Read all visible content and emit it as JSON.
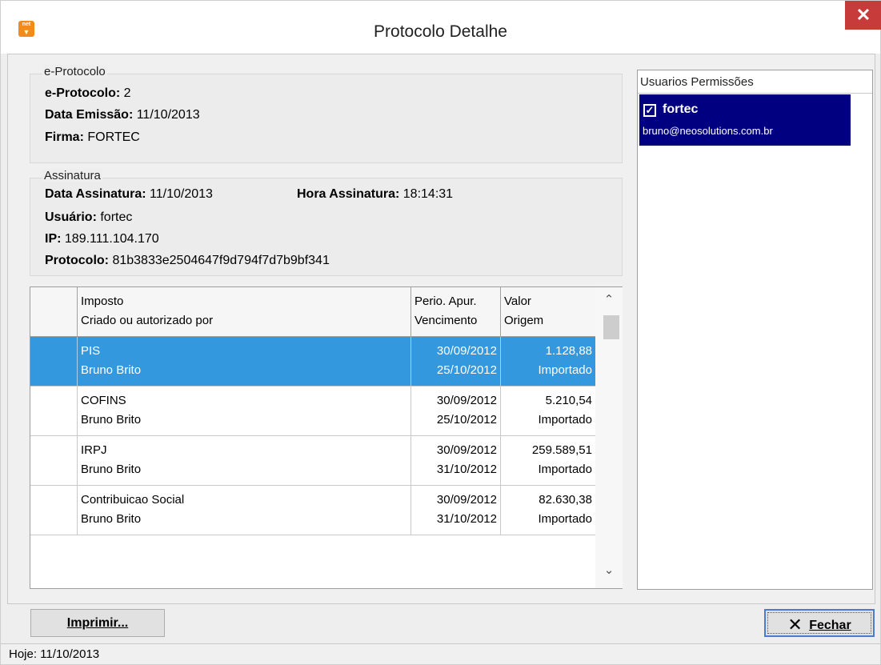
{
  "window": {
    "title": "Protocolo Detalhe",
    "app_icon_text": "net",
    "close_glyph": "✕"
  },
  "eprotocolo": {
    "caption": "e-Protocolo",
    "protocolo_label": "e-Protocolo:",
    "protocolo_value": "2",
    "data_emissao_label": "Data Emissão:",
    "data_emissao_value": "11/10/2013",
    "firma_label": "Firma:",
    "firma_value": "FORTEC"
  },
  "assinatura": {
    "caption": "Assinatura",
    "data_label": "Data Assinatura:",
    "data_value": "11/10/2013",
    "hora_label": "Hora Assinatura:",
    "hora_value": "18:14:31",
    "usuario_label": "Usuário:",
    "usuario_value": "fortec",
    "ip_label": "IP:",
    "ip_value": "189.111.104.170",
    "protocolo_label": "Protocolo:",
    "protocolo_value": "81b3833e2504647f9d794f7d7b9bf341"
  },
  "grid": {
    "headers": {
      "imposto": "Imposto",
      "criado": "Criado ou autorizado por",
      "perio": "Perio. Apur.",
      "vencimento": "Vencimento",
      "valor": "Valor",
      "origem": "Origem"
    },
    "rows": [
      {
        "imposto": "PIS",
        "criado": "Bruno Brito",
        "perio": "30/09/2012",
        "vencimento": "25/10/2012",
        "valor": "1.128,88",
        "origem": "Importado",
        "selected": true
      },
      {
        "imposto": "COFINS",
        "criado": "Bruno Brito",
        "perio": "30/09/2012",
        "vencimento": "25/10/2012",
        "valor": "5.210,54",
        "origem": "Importado",
        "selected": false
      },
      {
        "imposto": "IRPJ",
        "criado": "Bruno Brito",
        "perio": "30/09/2012",
        "vencimento": "31/10/2012",
        "valor": "259.589,51",
        "origem": "Importado",
        "selected": false
      },
      {
        "imposto": "Contribuicao Social",
        "criado": "Bruno Brito",
        "perio": "30/09/2012",
        "vencimento": "31/10/2012",
        "valor": "82.630,38",
        "origem": "Importado",
        "selected": false
      }
    ],
    "scroll_up": "⌃",
    "scroll_down": "⌄"
  },
  "permissions": {
    "header": "Usuarios Permissões",
    "items": [
      {
        "name": "fortec",
        "email": "bruno@neosolutions.com.br",
        "checked": true
      }
    ]
  },
  "buttons": {
    "print_label": "Imprimir...",
    "close_label": "Fechar",
    "close_glyph": "✕"
  },
  "status": {
    "text": "Hoje: 11/10/2013"
  }
}
